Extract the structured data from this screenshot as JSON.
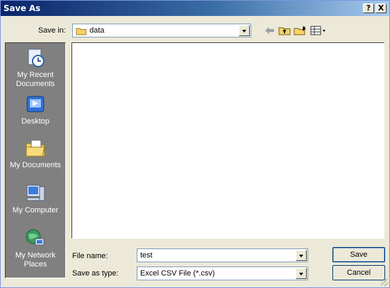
{
  "window": {
    "title": "Save As",
    "help_label": "?",
    "close_label": "X"
  },
  "save_in": {
    "label": "Save in:",
    "value": "data"
  },
  "places": [
    {
      "label": "My Recent Documents",
      "icon": "recent-documents-icon"
    },
    {
      "label": "Desktop",
      "icon": "desktop-icon"
    },
    {
      "label": "My Documents",
      "icon": "my-documents-icon"
    },
    {
      "label": "My Computer",
      "icon": "my-computer-icon"
    },
    {
      "label": "My Network Places",
      "icon": "network-places-icon"
    }
  ],
  "file_name": {
    "label": "File name:",
    "value": "test"
  },
  "save_as_type": {
    "label": "Save as type:",
    "value": "Excel CSV File  (*.csv)"
  },
  "buttons": {
    "save": "Save",
    "cancel": "Cancel"
  },
  "toolbar": {
    "back_icon": "back-arrow-icon",
    "up_icon": "up-folder-icon",
    "new_folder_icon": "new-folder-icon",
    "views_icon": "views-menu-icon"
  },
  "colors": {
    "title_start": "#0a246a",
    "title_end": "#a6caf0",
    "face": "#ece9d8",
    "places_bg": "#808080"
  }
}
